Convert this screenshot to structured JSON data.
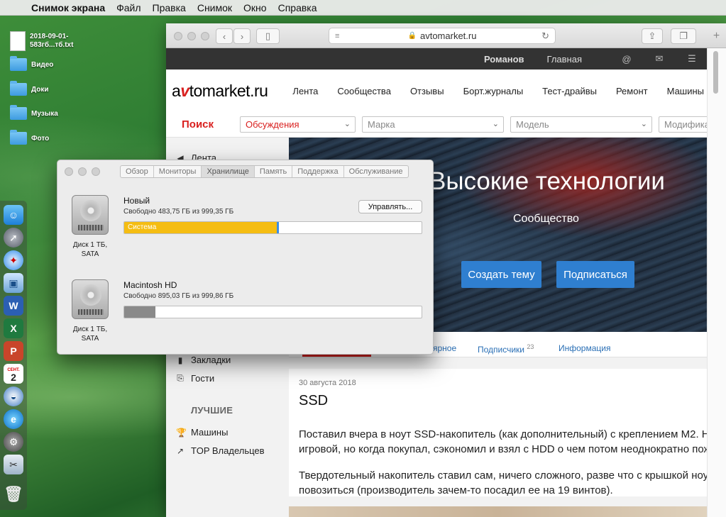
{
  "menubar": {
    "apple": "",
    "items": [
      "Снимок экрана",
      "Файл",
      "Правка",
      "Снимок",
      "Окно",
      "Справка"
    ]
  },
  "desktop": {
    "file": "2018-09-01-583гб...тб.txt",
    "file_line1": "2018-09-01-",
    "file_line2": "583гб...тб.txt",
    "folders": [
      "Видео",
      "Доки",
      "Музыка",
      "Фото"
    ]
  },
  "dock": {
    "calendar_day": "2",
    "calendar_month": "СЕНТ."
  },
  "browser": {
    "url": "avtomarket.ru",
    "topnav": {
      "user": "Романов",
      "home": "Главная"
    },
    "logo_pre": "a",
    "logo_v": "v",
    "logo_post": "tomarket.ru",
    "sitenav": [
      "Лента",
      "Сообщества",
      "Отзывы",
      "Борт.журналы",
      "Тест-драйвы",
      "Ремонт",
      "Машины"
    ],
    "search": {
      "label": "Поиск",
      "selects": [
        "Обсуждения",
        "Марка",
        "Модель",
        "Модифика"
      ]
    },
    "left_links": {
      "feed": "Лента",
      "bookmarks": "Закладки",
      "guests": "Гости",
      "section_best": "ЛУЧШИЕ",
      "cars": "Машины",
      "top_owners": "TOP Владельцев"
    },
    "hero": {
      "title": "Высокие технологии",
      "subtitle": "Сообщество",
      "create_button": "Создать тему",
      "subscribe_button": "Подписаться"
    },
    "tabs": {
      "popular_partial": "ярное",
      "subscribers": "Подписчики",
      "subscribers_count": "23",
      "info": "Информация"
    },
    "post": {
      "date": "30 августа 2018",
      "title": "SSD",
      "p1_line1": "Поставил вчера в ноут SSD-накопитель (как дополнительный) с креплением M2. Н",
      "p1_line2": "игровой, но когда покупал, сэкономил и взял с HDD о чем потом неоднократно пож",
      "p2_line1": "Твердотельный накопитель ставил сам, ничего сложного, разве что с крышкой ноу",
      "p2_line2": "повозиться (производитель зачем-то посадил ее на 19 винтов)."
    }
  },
  "about": {
    "tabs": [
      "Обзор",
      "Мониторы",
      "Хранилище",
      "Память",
      "Поддержка",
      "Обслуживание"
    ],
    "active_tab": "Хранилище",
    "manage_button": "Управлять...",
    "disks": [
      {
        "name": "Новый",
        "free": "Свободно 483,75 ГБ из 999,35 ГБ",
        "bar_label": "Система",
        "used_fraction": 0.516,
        "fill_color": "#f5bd12",
        "label_line1": "Диск 1 ТБ,",
        "label_line2": "SATA"
      },
      {
        "name": "Macintosh HD",
        "free": "Свободно 895,03 ГБ из 999,86 ГБ",
        "bar_label": "",
        "used_fraction": 0.105,
        "fill_color": "#8a8a8a",
        "label_line1": "Диск 1 ТБ,",
        "label_line2": "SATA"
      }
    ]
  },
  "colors": {
    "brand_red": "#d9201f",
    "link_blue": "#2a6fb5",
    "hero_button": "#2f7fd0"
  }
}
